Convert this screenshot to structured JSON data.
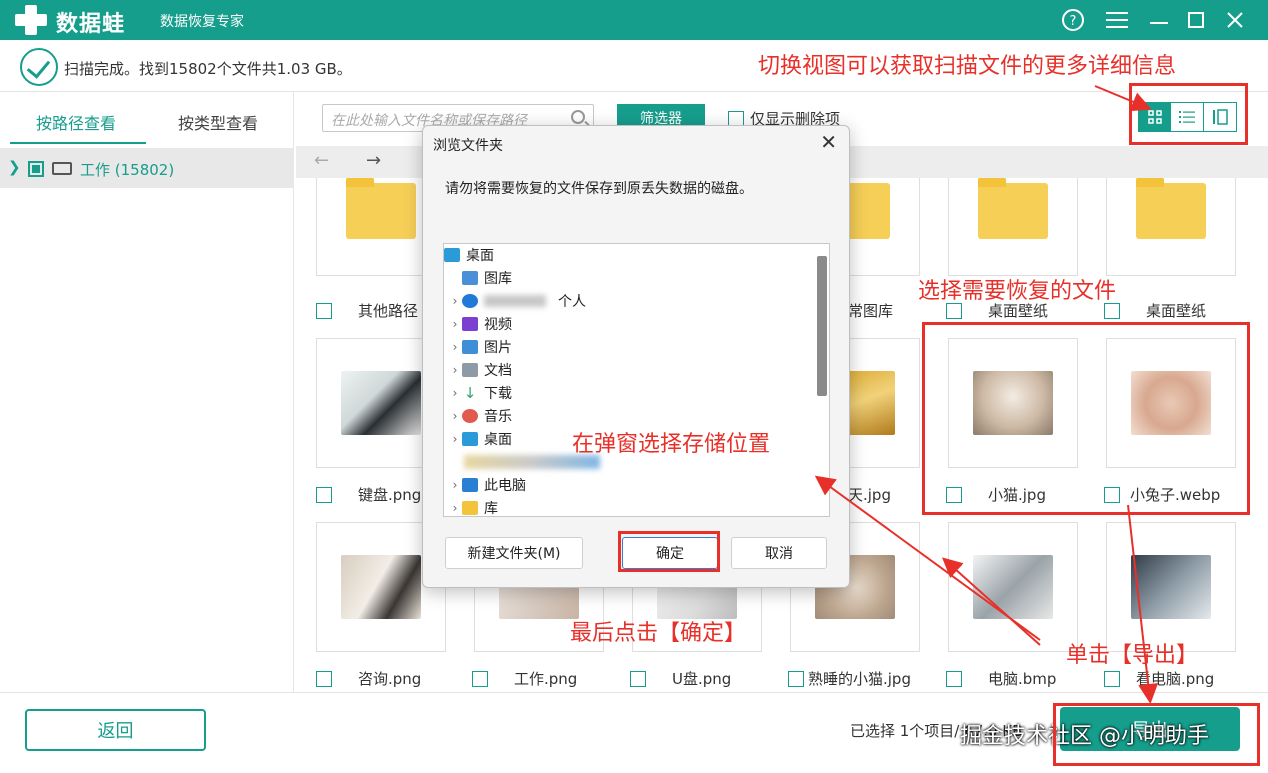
{
  "app": {
    "logo_text": "数据蛙",
    "subtitle": "数据恢复专家"
  },
  "titlebar_icons": [
    "help-icon",
    "menu-icon",
    "minimize-icon",
    "maximize-icon",
    "close-icon"
  ],
  "status": {
    "text": "扫描完成。找到15802个文件共1.03 GB。"
  },
  "left_panel": {
    "tabs": [
      {
        "label": "按路径查看",
        "active": true
      },
      {
        "label": "按类型查看",
        "active": false
      }
    ],
    "tree_item": {
      "label": "工作 (15802)"
    }
  },
  "toolbar": {
    "search_placeholder": "在此处输入文件名称或保存路径",
    "filter_label": "筛选器",
    "only_deleted_label": "仅显示删除项",
    "views": [
      "grid-view-icon",
      "list-view-icon",
      "detail-view-icon"
    ]
  },
  "files": {
    "row1_labels": [
      "其他路径",
      "常图库",
      "桌面壁纸",
      "桌面壁纸"
    ],
    "row2_labels": [
      "键盘.png",
      "天.jpg",
      "小猫.jpg",
      "小兔子.webp"
    ],
    "row3_labels": [
      "咨询.png",
      "工作.png",
      "U盘.png",
      "熟睡的小猫.jpg",
      "电脑.bmp",
      "看电脑.png"
    ]
  },
  "dialog": {
    "title": "浏览文件夹",
    "message": "请勿将需要恢复的文件保存到原丢失数据的磁盘。",
    "tree": [
      {
        "label": "桌面",
        "icon": "desktop-icon"
      },
      {
        "label": "图库",
        "icon": "gallery-icon"
      },
      {
        "label": "个人",
        "icon": "onedrive-icon"
      },
      {
        "label": "视频",
        "icon": "videos-icon"
      },
      {
        "label": "图片",
        "icon": "pictures-icon"
      },
      {
        "label": "文档",
        "icon": "documents-icon"
      },
      {
        "label": "下载",
        "icon": "downloads-icon"
      },
      {
        "label": "音乐",
        "icon": "music-icon"
      },
      {
        "label": "桌面",
        "icon": "desktop-icon"
      },
      {
        "label": "此电脑",
        "icon": "pc-icon"
      },
      {
        "label": "库",
        "icon": "library-icon"
      }
    ],
    "new_folder_label": "新建文件夹(M)",
    "ok_label": "确定",
    "cancel_label": "取消"
  },
  "bottom": {
    "back_label": "返回",
    "selected_info": "已选择 1个项目/ 67.0 KB",
    "export_label": "导出",
    "watermark": "掘金技术社区 @小明助手"
  },
  "annotations": {
    "switch_view": "切换视图可以获取扫描文件的更多详细信息",
    "select_files": "选择需要恢复的文件",
    "choose_location": "在弹窗选择存储位置",
    "click_ok": "最后点击【确定】",
    "click_export": "单击【导出】"
  },
  "colors": {
    "accent": "#169e8c",
    "annotation": "#e8302a",
    "folder": "#f6cf57"
  }
}
